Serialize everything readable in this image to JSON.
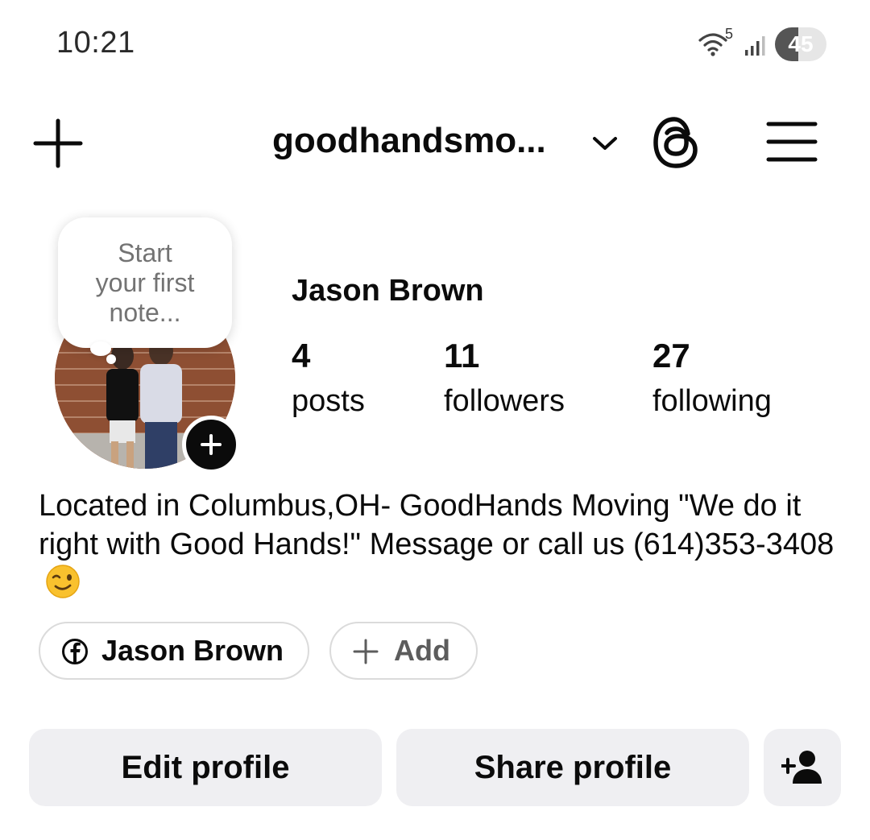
{
  "status_bar": {
    "time": "10:21",
    "wifi_badge": "5",
    "battery": "45",
    "battery_level_percent": 45,
    "icons": [
      "wifi-icon",
      "signal-icon",
      "battery-icon"
    ]
  },
  "top_bar": {
    "username": "goodhandsmo...",
    "icons": [
      "plus-icon",
      "chevron-down-icon",
      "threads-icon",
      "menu-icon"
    ]
  },
  "note": {
    "line1": "Start",
    "line2": "your first",
    "line3": "note..."
  },
  "profile": {
    "display_name": "Jason Brown",
    "stats": [
      {
        "value": "4",
        "label": "posts"
      },
      {
        "value": "11",
        "label": "followers"
      },
      {
        "value": "27",
        "label": "following"
      }
    ],
    "bio": "Located in Columbus,OH- GoodHands Moving \"We do it right with Good Hands!\" Message or call us (614)353-3408",
    "bio_emoji": "winking-face-emoji"
  },
  "links": {
    "facebook_label": "Jason Brown",
    "add_label": "Add"
  },
  "actions": {
    "edit_profile": "Edit profile",
    "share_profile": "Share profile",
    "add_user_icon": "add-person-icon"
  },
  "colors": {
    "button_bg": "#efeff2",
    "chip_border": "#dbdbdb",
    "secondary_text": "#737373"
  }
}
